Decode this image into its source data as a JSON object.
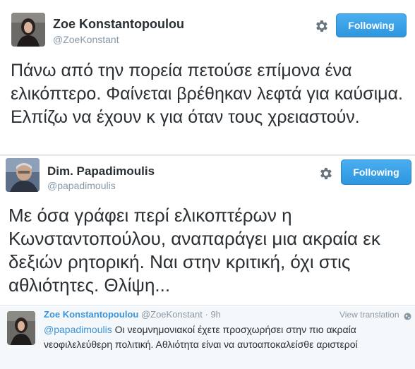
{
  "tweets": [
    {
      "name": "Zoe Konstantopoulou",
      "handle": "@ZoeKonstant",
      "follow_label": "Following",
      "text": "Πάνω από την πορεία πετούσε επίμονα ένα ελικόπτερο. Φαίνεται βρέθηκαν λεφτά για καύσιμα. Ελπίζω να έχουν κ για όταν τους χρειαστούν."
    },
    {
      "name": "Dim. Papadimoulis",
      "handle": "@papadimoulis",
      "follow_label": "Following",
      "text": "Με όσα γράφει περί ελικοπτέρων η Κωνσταντοπούλου, αναπαράγει μια ακραία εκ δεξιών ρητορική. Ναι στην κριτική, όχι στις αθλιότητες. Θλίψη..."
    }
  ],
  "reply": {
    "name": "Zoe Konstantopoulou",
    "handle": "@ZoeKonstant",
    "separator": "·",
    "time": "9h",
    "view_translation": "View translation",
    "mention": "@papadimoulis",
    "text": " Οι νεομνημονιακοί έχετε προσχωρήσει στην πιο ακραία νεοφιλελεύθερη πολιτική. Αθλιότητα είναι να αυτοαποκαλείσθε αριστεροί"
  },
  "colors": {
    "link": "#3b94d9",
    "follow_button": "#2d96de",
    "muted": "#8899a6",
    "text": "#292f33"
  },
  "icons": [
    "gear-icon",
    "globe-icon"
  ]
}
